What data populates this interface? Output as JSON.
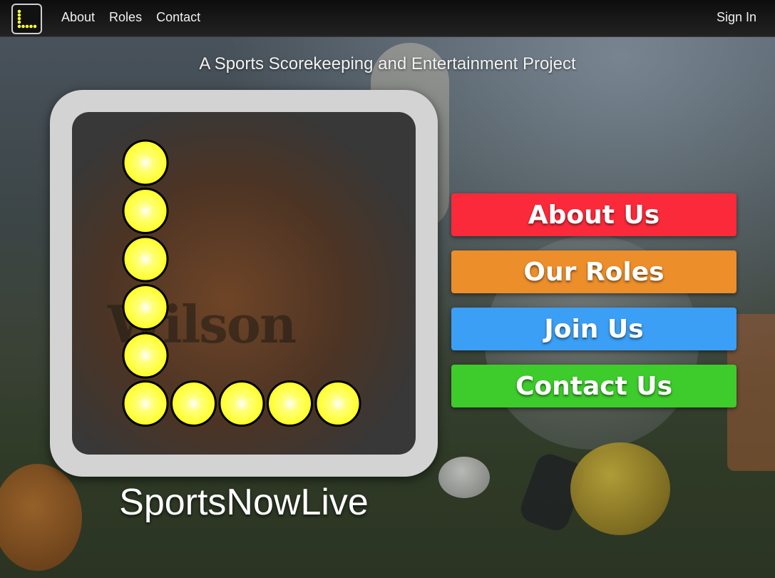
{
  "nav": {
    "logo_alt": "L",
    "links": [
      {
        "label": "About"
      },
      {
        "label": "Roles"
      },
      {
        "label": "Contact"
      }
    ],
    "signin_label": "Sign In"
  },
  "tagline": "A Sports Scorekeeping and Entertainment Project",
  "brand": {
    "name": "SportsNowLive",
    "logo_letter": "L",
    "background_print": "Wilson"
  },
  "buttons": [
    {
      "label": "About Us",
      "color": "#fa2a3a"
    },
    {
      "label": "Our Roles",
      "color": "#ec8e2a"
    },
    {
      "label": "Join Us",
      "color": "#3b9ff5"
    },
    {
      "label": "Contact Us",
      "color": "#3ecb2c"
    }
  ],
  "colors": {
    "dot": "#ffff33",
    "nav_bg": "#111111",
    "frame": "#d3d3d3"
  }
}
